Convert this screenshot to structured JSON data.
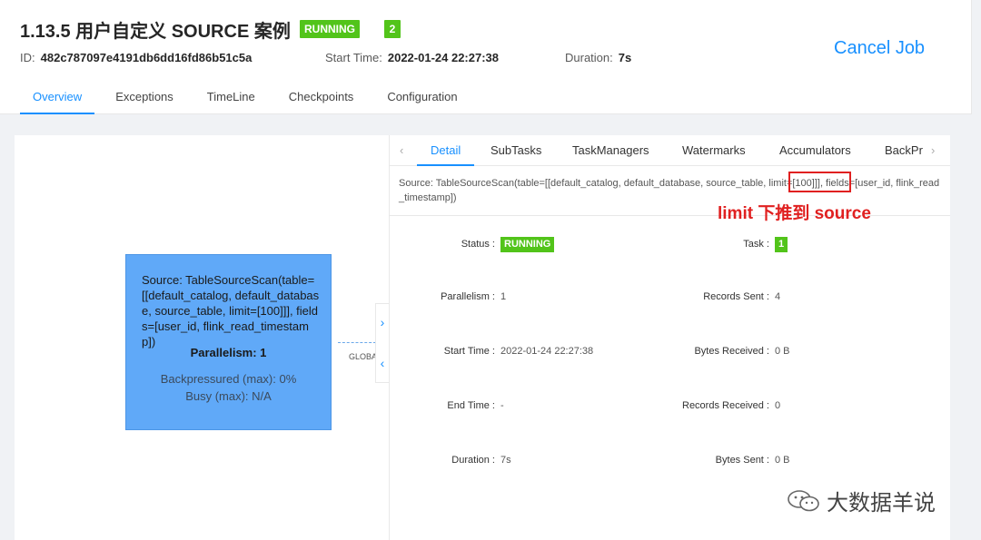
{
  "job": {
    "title": "1.13.5 用户自定义 SOURCE 案例",
    "status": "RUNNING",
    "task_count": "2",
    "id_label": "ID:",
    "id": "482c787097e4191db6dd16fd86b51c5a",
    "start_label": "Start Time:",
    "start_time": "2022-01-24 22:27:38",
    "duration_label": "Duration:",
    "duration": "7s",
    "cancel_label": "Cancel Job"
  },
  "tabs": [
    "Overview",
    "Exceptions",
    "TimeLine",
    "Checkpoints",
    "Configuration"
  ],
  "graph": {
    "node_desc": "Source: TableSourceScan(table=[[default_catalog, default_database, source_table, limit=[100]]], fields=[user_id, flink_read_timestamp])",
    "parallelism": "Parallelism: 1",
    "backpressured": "Backpressured (max): 0%",
    "busy": "Busy (max): N/A",
    "edge_label": "GLOBA",
    "expand_icon": "chevron-right-icon",
    "collapse_icon": "chevron-left-icon"
  },
  "detail": {
    "tabs": [
      "Detail",
      "SubTasks",
      "TaskManagers",
      "Watermarks",
      "Accumulators",
      "BackPr"
    ],
    "source": "Source: TableSourceScan(table=[[default_catalog, default_database, source_table, limit=[100]]], fields=[user_id, flink_read_timestamp])",
    "status_label": "Status",
    "status": "RUNNING",
    "task_label": "Task",
    "task": "1",
    "parallelism_label": "Parallelism",
    "parallelism": "1",
    "records_sent_label": "Records Sent",
    "records_sent": "4",
    "start_time_label": "Start Time",
    "start_time": "2022-01-24 22:27:38",
    "bytes_received_label": "Bytes Received",
    "bytes_received": "0 B",
    "end_time_label": "End Time",
    "end_time": "-",
    "records_received_label": "Records Received",
    "records_received": "0",
    "duration_label": "Duration",
    "duration": "7s",
    "bytes_sent_label": "Bytes Sent",
    "bytes_sent": "0 B"
  },
  "annotation": "limit 下推到 source",
  "watermark": "大数据羊说",
  "colors": {
    "accent": "#1890ff",
    "running": "#52c41a",
    "node": "#60a9f8",
    "annotation": "#e02020"
  }
}
